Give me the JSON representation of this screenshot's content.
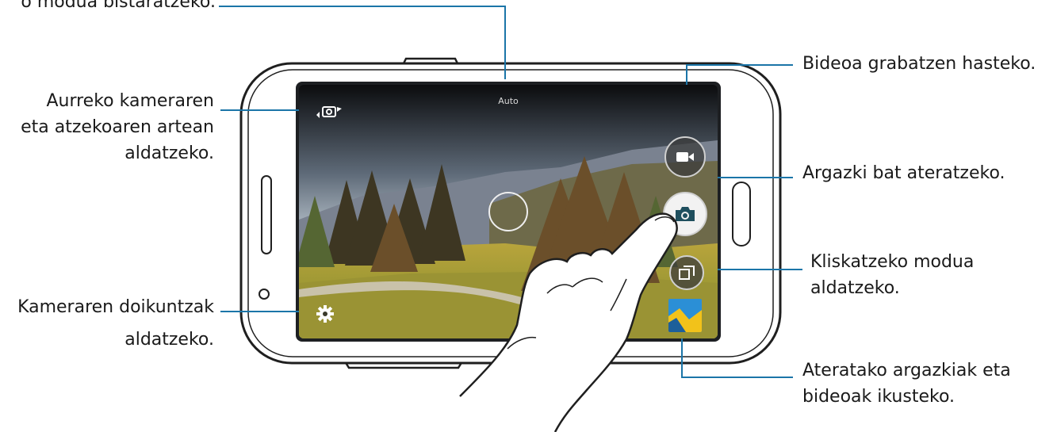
{
  "callouts": {
    "top_left_partial": "o modua bistaratzeko.",
    "switch_camera": [
      "Aurreko kameraren",
      "eta atzekoaren artean",
      "aldatzeko."
    ],
    "settings": [
      "Kameraren doikuntzak",
      "aldatzeko."
    ],
    "record_video": "Bideoa grabatzen hasteko.",
    "take_photo": "Argazki bat ateratzeko.",
    "shooting_mode": [
      "Kliskatzeko modua",
      "aldatzeko."
    ],
    "gallery": [
      "Ateratako argazkiak eta",
      "bideoak ikusteko."
    ]
  },
  "screen": {
    "mode_label": "Auto"
  },
  "icons": {
    "switch_camera": "switch-camera-icon",
    "settings": "gear-icon",
    "video": "video-camera-icon",
    "shutter": "camera-icon",
    "mode": "shooting-mode-icon",
    "gallery": "gallery-thumbnail-icon"
  },
  "colors": {
    "leader_line": "#1b75a8",
    "phone_outline": "#1f1f1f",
    "text": "#1a1a1a"
  }
}
